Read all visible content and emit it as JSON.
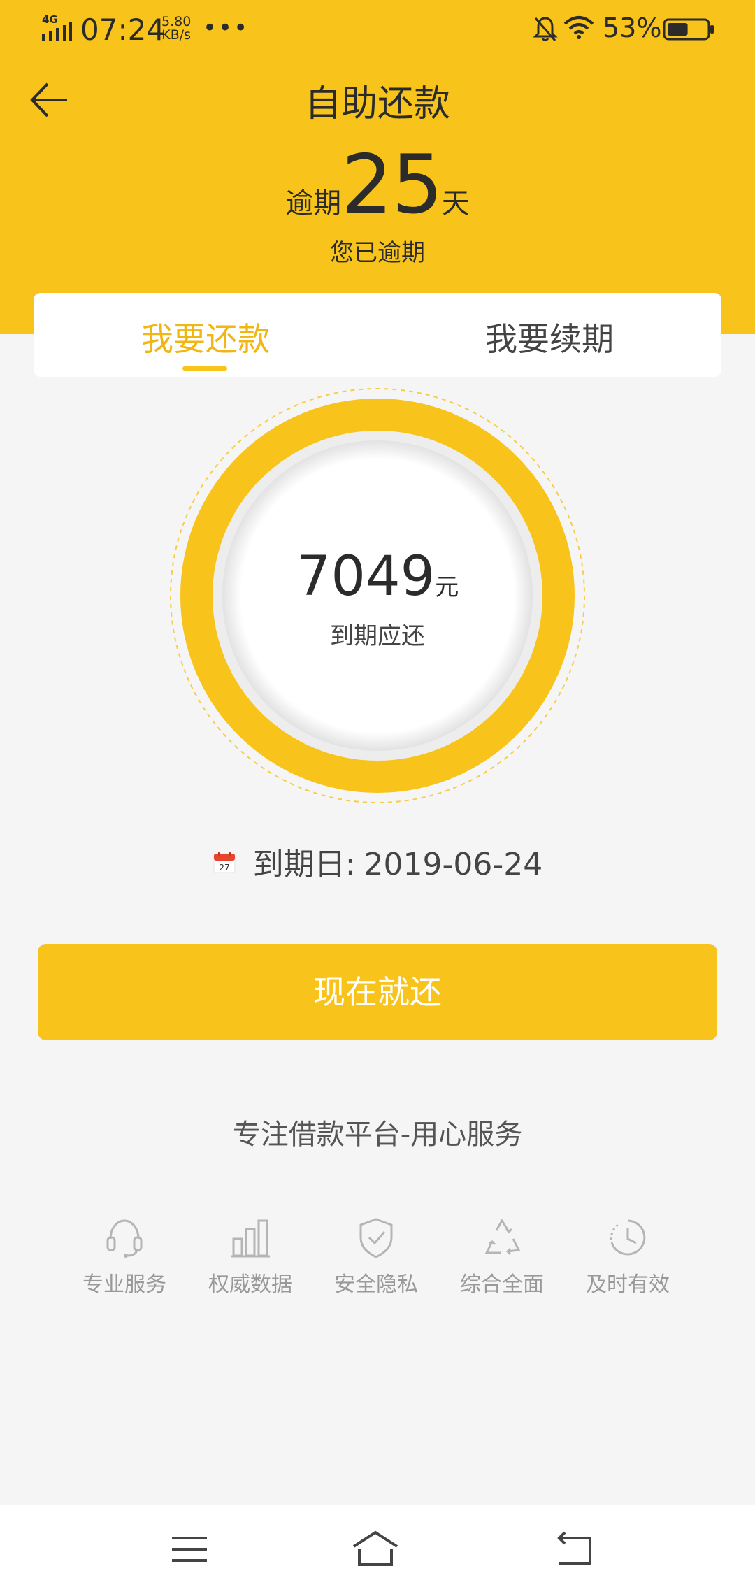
{
  "status_bar": {
    "network": "4G",
    "time": "07:24",
    "speed_value": "5.80",
    "speed_unit": "KB/s",
    "more": "•••",
    "battery_percent": "53%",
    "battery_level": 0.53
  },
  "header": {
    "title": "自助还款",
    "overdue_prefix": "逾期",
    "overdue_days": "25",
    "overdue_suffix": "天",
    "overdue_note": "您已逾期"
  },
  "tabs": [
    {
      "label": "我要还款",
      "active": true
    },
    {
      "label": "我要续期",
      "active": false
    }
  ],
  "summary": {
    "amount": "7049",
    "unit": "元",
    "label": "到期应还",
    "calendar_day": "27",
    "due_label": "到期日:",
    "due_date": "2019-06-24"
  },
  "actions": {
    "pay_now": "现在就还"
  },
  "slogan": "专注借款平台-用心服务",
  "features": [
    {
      "label": "专业服务",
      "icon": "headset-icon"
    },
    {
      "label": "权威数据",
      "icon": "bar-chart-icon"
    },
    {
      "label": "安全隐私",
      "icon": "shield-check-icon"
    },
    {
      "label": "综合全面",
      "icon": "recycle-icon"
    },
    {
      "label": "及时有效",
      "icon": "clock-icon"
    }
  ],
  "colors": {
    "brand": "#f8c31a",
    "active_tab": "#f0b614",
    "background": "#f5f5f5"
  }
}
